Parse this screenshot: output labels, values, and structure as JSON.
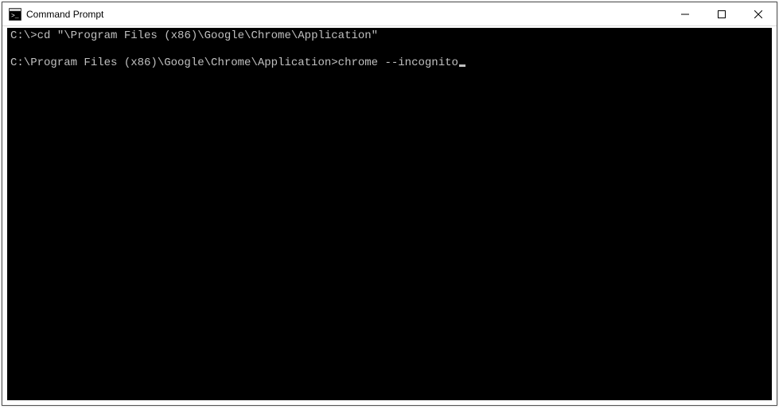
{
  "window": {
    "title": "Command Prompt"
  },
  "terminal": {
    "lines": [
      {
        "prompt": "C:\\>",
        "command": "cd \"\\Program Files (x86)\\Google\\Chrome\\Application\""
      },
      {
        "blank": true
      },
      {
        "prompt": "C:\\Program Files (x86)\\Google\\Chrome\\Application>",
        "command": "chrome --incognito",
        "cursor": true
      }
    ]
  }
}
